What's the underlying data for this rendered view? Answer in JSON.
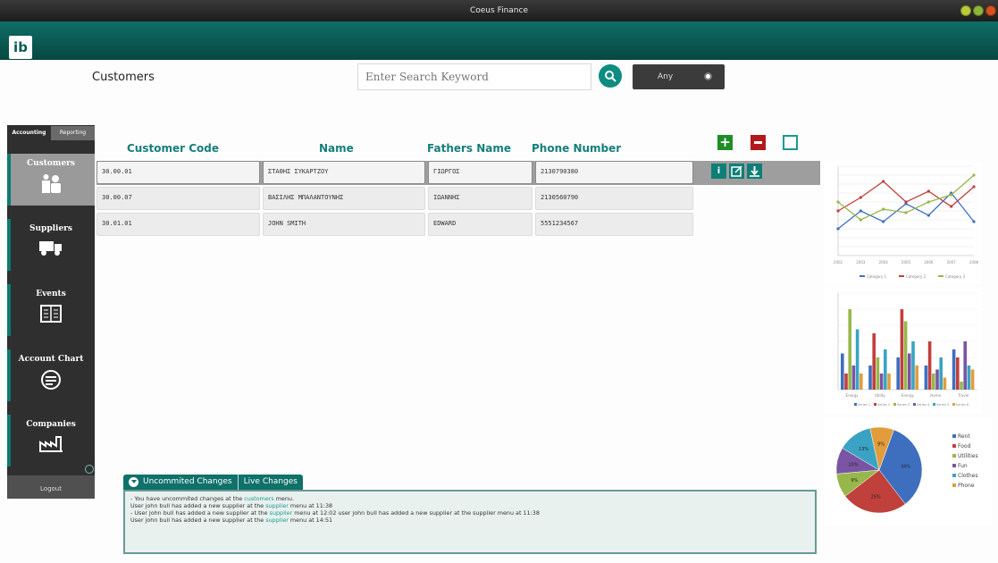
{
  "window": {
    "title": "Coeus Finance"
  },
  "app": {
    "logo": "ib"
  },
  "header": {
    "page_title": "Customers",
    "search_placeholder": "Enter Search Keyword",
    "filter_label": "Any"
  },
  "sidebar": {
    "tabs": [
      {
        "label": "Accounting"
      },
      {
        "label": "Reporting"
      }
    ],
    "items": [
      {
        "label": "Customers",
        "icon": "customers-icon"
      },
      {
        "label": "Suppliers",
        "icon": "truck-icon"
      },
      {
        "label": "Events",
        "icon": "calendar-book-icon"
      },
      {
        "label": "Account Chart",
        "icon": "account-chart-icon"
      },
      {
        "label": "Companies",
        "icon": "factory-icon"
      }
    ],
    "logout": "Logout"
  },
  "table": {
    "columns": [
      "Customer Code",
      "Name",
      "Fathers Name",
      "Phone Number"
    ],
    "rows": [
      {
        "code": "30.00.01",
        "name": "ΣΤΑΘΗΣ ΣΥΚΑΡΤΖΟΥ",
        "father": "ΓΙΩΡΓΟΣ",
        "phone": "2130790380"
      },
      {
        "code": "30.00.07",
        "name": "ΒΑΣΙΛΗΣ ΜΠΑΛΑΝΤΟΥΝΗΣ",
        "father": "ΙΩΑΝΝΗΣ",
        "phone": "2130560790"
      },
      {
        "code": "30.01.01",
        "name": "JOHN SMITH",
        "father": "EDWARD",
        "phone": "5551234567"
      }
    ]
  },
  "changes": {
    "tabs": [
      "Uncommited Changes",
      "Live Changes"
    ],
    "lines": [
      {
        "pre": "- You have uncommited changes at the ",
        "link": "customers",
        "post": " menu."
      },
      {
        "pre": "  User john bull has added a new supplier at the ",
        "link": "supplier",
        "post": " menu at 11:38"
      },
      {
        "pre": "- User john bull has added a new supplier at the ",
        "link": "supplier",
        "post": " menu at 12:02 user john bull has added a new supplier at the supplier menu at 11:38"
      },
      {
        "pre": "  User john bull has added a new supplier at the ",
        "link": "supplier",
        "post": " menu at 14:51"
      }
    ]
  },
  "colors": {
    "teal": "#0f7169",
    "accent": "#157f7a"
  },
  "chart_data": [
    {
      "type": "line",
      "x": [
        "2002",
        "2003",
        "2004",
        "2005",
        "2006",
        "2007",
        "2008"
      ],
      "series": [
        {
          "name": "Category 1",
          "values": [
            30,
            50,
            38,
            58,
            45,
            70,
            38
          ]
        },
        {
          "name": "Category 2",
          "values": [
            50,
            65,
            83,
            60,
            72,
            55,
            77
          ]
        },
        {
          "name": "Category 3",
          "values": [
            60,
            40,
            52,
            48,
            60,
            68,
            90
          ]
        }
      ],
      "ylim": [
        0,
        100
      ]
    },
    {
      "type": "bar",
      "categories": [
        "Energy",
        "Utility",
        "Energy",
        "Home",
        "Travel"
      ],
      "series": [
        {
          "name": "Series 1",
          "values": [
            45,
            30,
            40,
            30,
            50
          ]
        },
        {
          "name": "Series 2",
          "values": [
            20,
            70,
            100,
            60,
            40
          ]
        },
        {
          "name": "Series 3",
          "values": [
            100,
            40,
            85,
            20,
            10
          ]
        },
        {
          "name": "Series 4",
          "values": [
            30,
            20,
            45,
            25,
            60
          ]
        },
        {
          "name": "Series 5",
          "values": [
            75,
            50,
            60,
            40,
            30
          ]
        },
        {
          "name": "Series 6",
          "values": [
            20,
            20,
            30,
            15,
            25
          ]
        }
      ],
      "ylim": [
        0,
        120
      ]
    },
    {
      "type": "pie",
      "categories": [
        "Rent",
        "Food",
        "Utilities",
        "Fun",
        "Clothes",
        "Phone"
      ],
      "values": [
        34,
        25,
        9,
        10,
        13,
        9
      ],
      "legend": "right"
    }
  ]
}
